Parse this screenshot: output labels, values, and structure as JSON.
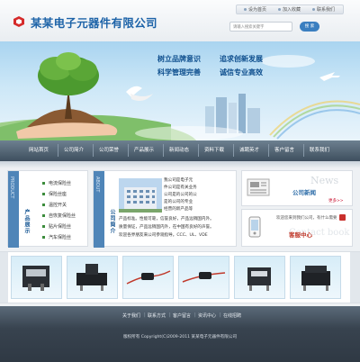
{
  "header": {
    "company_name": "某某电子元器件有限公司",
    "links": [
      "设为首页",
      "加入收藏",
      "联系我们"
    ],
    "search_placeholder": "请输入搜索关键字",
    "search_button": "搜 索"
  },
  "banner": {
    "slogans": [
      "树立品牌意识",
      "追求创新发展",
      "科学管理完善",
      "诚信专业高效"
    ]
  },
  "nav": {
    "items": [
      "网站首页",
      "公司简介",
      "公司荣誉",
      "产品展示",
      "新闻动态",
      "资料下载",
      "诚聘英才",
      "客户留言",
      "联系我们"
    ]
  },
  "products": {
    "en_label": "PRODUCT",
    "title": "产品展示",
    "items": [
      "电流保险丝",
      "保险丝座",
      "温控开关",
      "自恢复保险丝",
      "贴片保险丝",
      "汽车保险丝"
    ]
  },
  "about": {
    "en_label": "ABOUT",
    "title": "公司简介",
    "text_lines": [
      "我公司是电子元",
      "件公司是有关业务",
      "公司是的公司的公",
      "是的公司的专业",
      "经营的新产品等",
      "公司有限责任公司"
    ],
    "text_full_lines": [
      "产品标准。性能可靠，信誉良好，产品远销国内外。",
      "质量保证，产品远销国内外，在中国有良好的声誉。",
      "欢迎各界朋友来公司参观指导。CCC、UL、VDE"
    ]
  },
  "news": {
    "title": "公司新闻",
    "en_label": "News",
    "more": "更多>>"
  },
  "service": {
    "text": "欢迎您来到我们公司，有什么需要",
    "title": "客服中心",
    "en_label": "Contact book"
  },
  "footer": {
    "links": [
      "关于我们",
      "联系方式",
      "客户留言",
      "资讯中心",
      "在线招聘"
    ],
    "copyright": "版权所有 Copyright(C)2009-2011 某某电子元器件有限公司"
  },
  "colors": {
    "brand": "#1d63a8",
    "accent_green": "#3c8c3c",
    "nav_bg": "#3e4f5e",
    "footer_bg": "#38434f"
  }
}
